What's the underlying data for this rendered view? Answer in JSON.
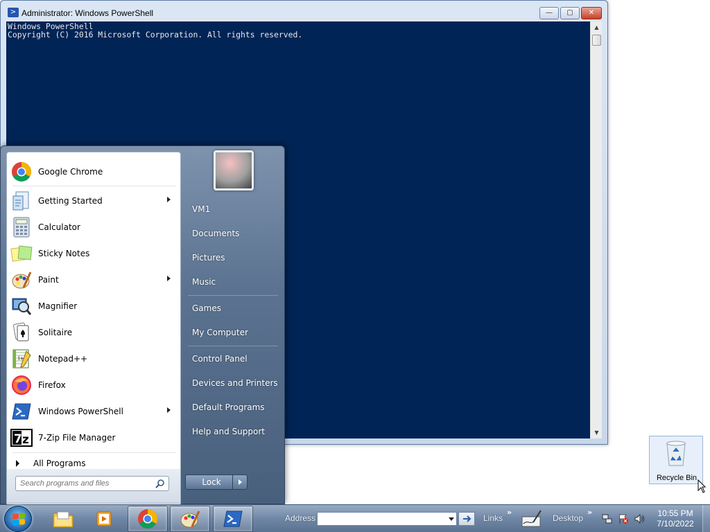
{
  "window": {
    "title": "Administrator: Windows PowerShell",
    "console_lines": [
      "Windows PowerShell",
      "Copyright (C) 2016 Microsoft Corporation. All rights reserved."
    ],
    "minimize_label": "—",
    "maximize_label": "▢",
    "close_label": "✕"
  },
  "start_menu": {
    "pinned": [
      {
        "label": "Google Chrome",
        "icon": "chrome-icon"
      },
      {
        "label": "Getting Started",
        "icon": "getting-started-icon",
        "submenu": true
      },
      {
        "label": "Calculator",
        "icon": "calculator-icon"
      },
      {
        "label": "Sticky Notes",
        "icon": "sticky-notes-icon"
      },
      {
        "label": "Paint",
        "icon": "paint-icon",
        "submenu": true
      },
      {
        "label": "Magnifier",
        "icon": "magnifier-icon"
      },
      {
        "label": "Solitaire",
        "icon": "solitaire-icon"
      },
      {
        "label": "Notepad++",
        "icon": "notepadpp-icon"
      },
      {
        "label": "Firefox",
        "icon": "firefox-icon"
      },
      {
        "label": "Windows PowerShell",
        "icon": "powershell-icon",
        "submenu": true
      },
      {
        "label": "7-Zip File Manager",
        "icon": "7zip-icon"
      }
    ],
    "all_programs": "All Programs",
    "search_placeholder": "Search programs and files",
    "right_links": [
      "VM1",
      "Documents",
      "Pictures",
      "Music",
      "Games",
      "My Computer",
      "Control Panel",
      "Devices and Printers",
      "Default Programs",
      "Help and Support"
    ],
    "lock_label": "Lock"
  },
  "desktop": {
    "recycle_bin_label": "Recycle Bin"
  },
  "taskbar": {
    "address_label": "Address",
    "address_value": "",
    "links_label": "Links",
    "desktop_label": "Desktop",
    "chevron": "»",
    "time": "10:55 PM",
    "date": "7/10/2022"
  }
}
